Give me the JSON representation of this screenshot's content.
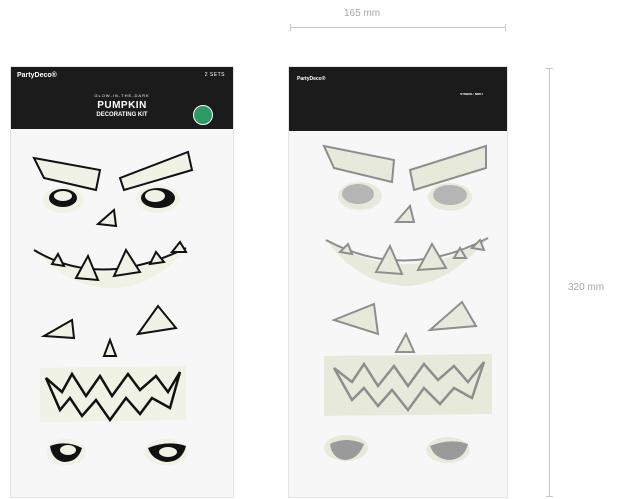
{
  "dimensions": {
    "width": "165 mm",
    "height": "320 mm"
  },
  "front": {
    "brand": "PartyDeco®",
    "sets": "2 SETS",
    "subtitle": "GLOW-IN-THE-DARK",
    "title": "PUMPKIN",
    "kit": "DECORATING KIT"
  },
  "back": {
    "brand": "PartyDeco®",
    "symbol": "SYMBOL: NDK1"
  },
  "colors": {
    "header": "#1b1b1b",
    "sticker_base": "#eff2e4",
    "sticker_base_back": "#e7eadb",
    "outline": "#111111",
    "outline_back": "#8e8e8e",
    "badge": "#2d9a64"
  }
}
